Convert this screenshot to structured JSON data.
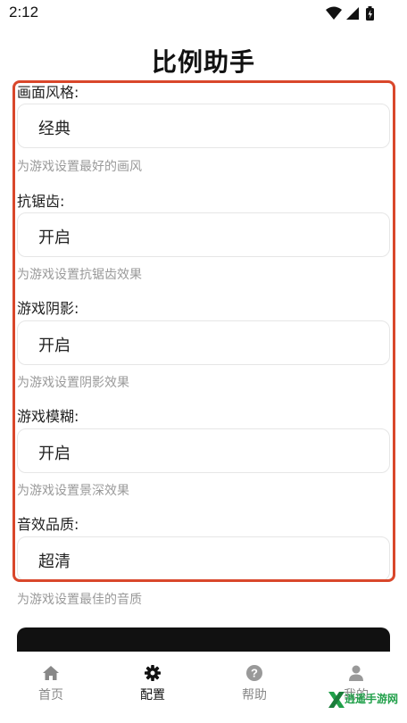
{
  "status_bar": {
    "time": "2:12",
    "icons": [
      "wifi-icon",
      "cellular-signal-icon",
      "battery-icon"
    ]
  },
  "page_title": "比例助手",
  "settings": [
    {
      "label": "画面风格:",
      "value": "经典",
      "hint": "为游戏设置最好的画风"
    },
    {
      "label": "抗锯齿:",
      "value": "开启",
      "hint": "为游戏设置抗锯齿效果"
    },
    {
      "label": "游戏阴影:",
      "value": "开启",
      "hint": "为游戏设置阴影效果"
    },
    {
      "label": "游戏模糊:",
      "value": "开启",
      "hint": "为游戏设置景深效果"
    },
    {
      "label": "音效品质:",
      "value": "超清",
      "hint": "为游戏设置最佳的音质"
    }
  ],
  "bottom_nav": [
    {
      "label": "首页",
      "icon": "home-icon",
      "active": false
    },
    {
      "label": "配置",
      "icon": "gear-icon",
      "active": true
    },
    {
      "label": "帮助",
      "icon": "help-icon",
      "active": false
    },
    {
      "label": "我的",
      "icon": "user-icon",
      "active": false
    }
  ],
  "watermark": {
    "text": "逍遥手游网"
  },
  "colors": {
    "highlight": "#d9472b",
    "hint_text": "#9a9a9a",
    "active_nav": "#111111",
    "inactive_nav": "#888888",
    "watermark": "#21a04a"
  }
}
